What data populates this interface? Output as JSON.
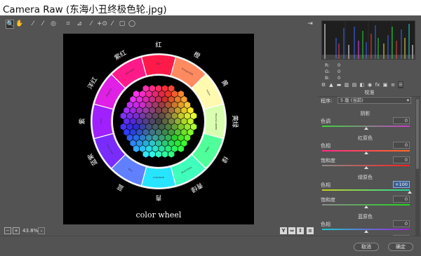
{
  "window": {
    "title": "Camera Raw (东海小丑终极色轮.jpg)"
  },
  "toolbar": {
    "tools": [
      {
        "icon": "zoom-icon",
        "glyph": "🔍"
      },
      {
        "icon": "hand-icon",
        "glyph": "✋"
      },
      {
        "icon": "white-balance-icon",
        "glyph": "⁄"
      },
      {
        "icon": "color-sampler-icon",
        "glyph": "⁄"
      },
      {
        "icon": "targeted-adjustment-icon",
        "glyph": "◎"
      },
      {
        "icon": "crop-icon",
        "glyph": "⌗"
      },
      {
        "icon": "straighten-icon",
        "glyph": "⊿"
      },
      {
        "icon": "spot-removal-icon",
        "glyph": "⁄"
      },
      {
        "icon": "red-eye-icon",
        "glyph": "+⊙"
      },
      {
        "icon": "adjustment-brush-icon",
        "glyph": "⁄"
      },
      {
        "icon": "graduated-filter-icon",
        "glyph": "▢"
      },
      {
        "icon": "radial-filter-icon",
        "glyph": "◯"
      }
    ],
    "open_preferences_glyph": "⇥"
  },
  "photo": {
    "caption": "color wheel",
    "hue_labels": [
      "红",
      "橙",
      "黄",
      "黄绿",
      "绿",
      "青绿",
      "青",
      "蓝",
      "蓝紫",
      "紫",
      "洋红",
      "紫红"
    ],
    "segment_colors": [
      "#ff1a4a",
      "#ff8a60",
      "#fffab0",
      "#d8ffb0",
      "#50ff9a",
      "#40ffbd",
      "#27e5ff",
      "#6080ff",
      "#7a2cff",
      "#a020ff",
      "#e020e6",
      "#ff1a8a"
    ],
    "segment_texts": [
      "Red",
      "Orange-RED",
      "Yellow",
      "YELLOW-GREEN",
      "Green",
      "Blue-Green",
      "CYAN-BLUE",
      "Blue",
      "Blue-violet",
      "Violet",
      "Magenta",
      "Red-violet"
    ]
  },
  "bottom_bar": {
    "zoom": "43.8%",
    "zoom_caret": "⌄",
    "view_buttons": [
      "Y",
      "⇔",
      "⇕",
      "≡"
    ]
  },
  "histogram": {
    "r_label": "R:",
    "g_label": "G:",
    "b_label": "B:",
    "r": "0",
    "g": "0",
    "b": "0"
  },
  "panel_tabs": [
    "⚙",
    "▲",
    "▬",
    "▥",
    "▤",
    "◧",
    "◉",
    "fx",
    "▣",
    "≡",
    "☰"
  ],
  "panel": {
    "header": "校准",
    "process_label": "程序:",
    "process_value": "5 版 (当前)",
    "sections": [
      {
        "title": "阴影",
        "rows": [
          {
            "label": "色调",
            "value": "0",
            "track": "linear-gradient(to right,#3cd63c,#c83cc8)",
            "pos": 0.5
          }
        ]
      },
      {
        "title": "红原色",
        "rows": [
          {
            "label": "色相",
            "value": "0",
            "track": "linear-gradient(to right,#ff2a8a,#ff6a20)",
            "pos": 0.5
          },
          {
            "label": "饱和度",
            "value": "0",
            "track": "linear-gradient(to right,#8a8a8a,#ff2020)",
            "pos": 0.5
          }
        ]
      },
      {
        "title": "绿原色",
        "rows": [
          {
            "label": "色相",
            "value": "+100",
            "track": "linear-gradient(to right,#c8d020,#20d8a0)",
            "pos": 1.0,
            "hl": true
          },
          {
            "label": "饱和度",
            "value": "0",
            "track": "linear-gradient(to right,#8a8a8a,#20d820)",
            "pos": 0.5
          }
        ]
      },
      {
        "title": "蓝原色",
        "rows": [
          {
            "label": "色相",
            "value": "0",
            "track": "linear-gradient(to right,#20c8d0,#a020d8)",
            "pos": 0.5
          },
          {
            "label": "饱和度",
            "value": "0",
            "track": "linear-gradient(to right,#8a8a8a,#2040ff)",
            "pos": 0.5
          }
        ]
      }
    ]
  },
  "footer": {
    "cancel": "取消",
    "ok": "确定"
  }
}
